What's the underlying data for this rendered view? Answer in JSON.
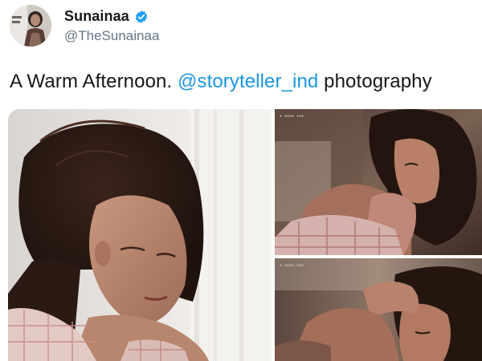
{
  "author": {
    "display_name": "Sunainaa",
    "handle": "@TheSunainaa",
    "verified": true,
    "avatar_icon": "profile-photo"
  },
  "tweet": {
    "text_before": "A Warm Afternoon. ",
    "mention": "@storyteller_ind",
    "text_after": " photography"
  },
  "colors": {
    "mention": "#1b95e0",
    "verified_badge": "#1da1f2",
    "name": "#14171a",
    "handle": "#657786"
  },
  "media": {
    "photos": [
      {
        "name": "photo-woman-by-curtain"
      },
      {
        "name": "photo-woman-looking-over-shoulder"
      },
      {
        "name": "photo-woman-eyes-closed"
      }
    ]
  }
}
